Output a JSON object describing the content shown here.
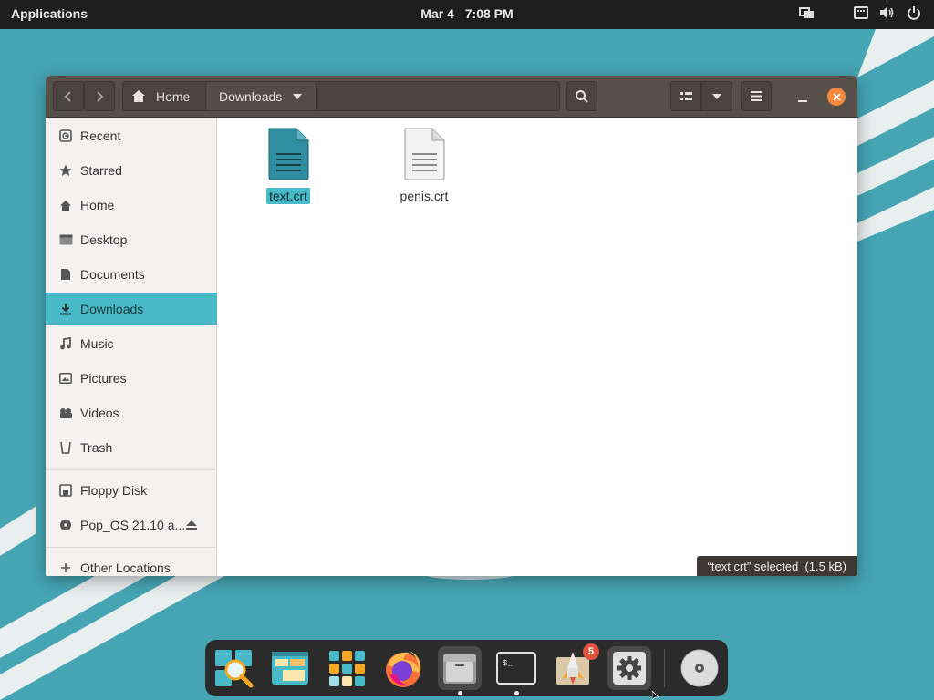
{
  "topbar": {
    "applications": "Applications",
    "date": "Mar 4",
    "time": "7:08 PM"
  },
  "window": {
    "pathbar": {
      "home": "Home",
      "current": "Downloads"
    },
    "sidebar": {
      "places": [
        {
          "label": "Recent",
          "icon": "clock-icon"
        },
        {
          "label": "Starred",
          "icon": "star-icon"
        },
        {
          "label": "Home",
          "icon": "home-icon"
        },
        {
          "label": "Desktop",
          "icon": "desktop-icon"
        },
        {
          "label": "Documents",
          "icon": "document-icon"
        },
        {
          "label": "Downloads",
          "icon": "download-icon",
          "active": true
        },
        {
          "label": "Music",
          "icon": "music-icon"
        },
        {
          "label": "Pictures",
          "icon": "picture-icon"
        },
        {
          "label": "Videos",
          "icon": "video-icon"
        },
        {
          "label": "Trash",
          "icon": "trash-icon"
        }
      ],
      "devices": [
        {
          "label": "Floppy Disk",
          "icon": "floppy-icon"
        },
        {
          "label": "Pop_OS 21.10 a...",
          "icon": "disc-icon"
        }
      ],
      "other": {
        "label": "Other Locations",
        "icon": "plus-icon"
      }
    },
    "files": [
      {
        "name": "text.crt",
        "selected": true
      },
      {
        "name": "penis.crt",
        "selected": false
      }
    ],
    "status": "“text.crt” selected  (1.5 kB)"
  },
  "dock": {
    "badge_count": "5",
    "apps": [
      "search",
      "files-manager",
      "app-grid",
      "firefox",
      "file-manager",
      "terminal",
      "pop-shop",
      "settings",
      "disc"
    ]
  },
  "colors": {
    "accent": "#48b9c7",
    "headerbar": "#574f4a",
    "close": "#f5893d",
    "wallpaper": "#46a5b3"
  }
}
